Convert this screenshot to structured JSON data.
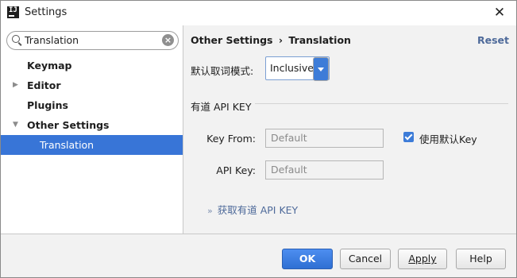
{
  "window": {
    "title": "Settings",
    "app_icon_glyph": "IJ"
  },
  "sidebar": {
    "search": {
      "value": "Translation"
    },
    "items": [
      {
        "label": "Keymap",
        "level": 0,
        "expandable": false,
        "selected": false
      },
      {
        "label": "Editor",
        "level": 0,
        "expandable": true,
        "expanded": false,
        "selected": false
      },
      {
        "label": "Plugins",
        "level": 0,
        "expandable": false,
        "selected": false
      },
      {
        "label": "Other Settings",
        "level": 0,
        "expandable": true,
        "expanded": true,
        "selected": false
      },
      {
        "label": "Translation",
        "level": 1,
        "expandable": false,
        "selected": true
      }
    ]
  },
  "content": {
    "breadcrumb": {
      "parent": "Other Settings",
      "separator": "›",
      "current": "Translation"
    },
    "reset_label": "Reset",
    "mode_label": "默认取词模式:",
    "mode_select_value": "Inclusive",
    "section_title": "有道 API KEY",
    "key_from_label": "Key From:",
    "key_from_value": "Default",
    "api_key_label": "API Key:",
    "api_key_value": "Default",
    "use_default_checked": true,
    "use_default_label": "使用默认Key",
    "get_key_chevron": "»",
    "get_key_link": "获取有道 API KEY"
  },
  "footer": {
    "ok": "OK",
    "cancel": "Cancel",
    "apply": "Apply",
    "help": "Help"
  },
  "colors": {
    "accent": "#3875d7",
    "link": "#4e6a9a",
    "primary_button": "#3d7cd8"
  }
}
